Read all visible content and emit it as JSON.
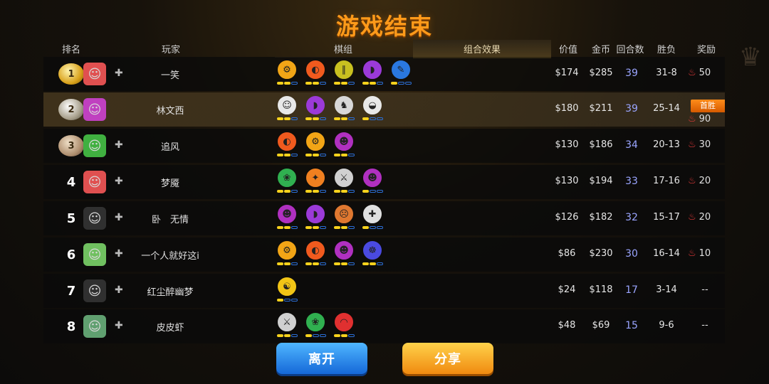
{
  "title": "游戏结束",
  "headers": {
    "rank": "排名",
    "player": "玩家",
    "pieces": "棋组",
    "combo": "组合效果",
    "value": "价值",
    "gold": "金币",
    "rounds": "回合数",
    "winloss": "胜负",
    "reward": "奖励"
  },
  "buttons": {
    "leave": "离开",
    "share": "分享"
  },
  "first_win_badge": "首胜",
  "rows": [
    {
      "rank": "1",
      "medal": "gold",
      "name": "一笑",
      "friend": true,
      "avatar_bg": "#e05050",
      "value": "$174",
      "gold": "$285",
      "rounds": "39",
      "wl": "31-8",
      "reward": "50",
      "synergies": [
        {
          "color": "#f2a516",
          "icon": "⚙",
          "bars": [
            1,
            1,
            0
          ]
        },
        {
          "color": "#f05a1e",
          "icon": "◐",
          "bars": [
            1,
            1,
            0
          ]
        },
        {
          "color": "#c8c020",
          "icon": "∥",
          "bars": [
            1,
            1,
            0
          ]
        },
        {
          "color": "#9b3ad8",
          "icon": "◗",
          "bars": [
            1,
            1,
            0
          ]
        },
        {
          "color": "#2a78e0",
          "icon": "✎",
          "bars": [
            1,
            0,
            0
          ]
        }
      ]
    },
    {
      "rank": "2",
      "medal": "silver",
      "name": "林文西",
      "friend": false,
      "avatar_bg": "#c040c0",
      "value": "$180",
      "gold": "$211",
      "rounds": "39",
      "wl": "25-14",
      "reward": "90",
      "first_win": true,
      "synergies": [
        {
          "color": "#e8e8e8",
          "icon": "☺",
          "bars": [
            1,
            1,
            0
          ]
        },
        {
          "color": "#9b3ad8",
          "icon": "◗",
          "bars": [
            1,
            1,
            0
          ]
        },
        {
          "color": "#d8d8d8",
          "icon": "♞",
          "bars": [
            1,
            1,
            0
          ]
        },
        {
          "color": "#e8e8e8",
          "icon": "◒",
          "bars": [
            1,
            0,
            0
          ]
        }
      ]
    },
    {
      "rank": "3",
      "medal": "bronze",
      "name": "追风",
      "friend": true,
      "avatar_bg": "#40b040",
      "value": "$130",
      "gold": "$186",
      "rounds": "34",
      "wl": "20-13",
      "reward": "30",
      "synergies": [
        {
          "color": "#f05a1e",
          "icon": "◐",
          "bars": [
            1,
            1,
            0
          ]
        },
        {
          "color": "#f2a516",
          "icon": "⚙",
          "bars": [
            1,
            1,
            0
          ]
        },
        {
          "color": "#b030c0",
          "icon": "☻",
          "bars": [
            1,
            1,
            0
          ]
        }
      ]
    },
    {
      "rank": "4",
      "medal": "",
      "name": "梦魇",
      "friend": true,
      "avatar_bg": "#e05050",
      "value": "$130",
      "gold": "$194",
      "rounds": "33",
      "wl": "17-16",
      "reward": "20",
      "synergies": [
        {
          "color": "#30b050",
          "icon": "❀",
          "bars": [
            1,
            1,
            0
          ]
        },
        {
          "color": "#f08020",
          "icon": "✦",
          "bars": [
            1,
            1,
            0
          ]
        },
        {
          "color": "#d0d0d0",
          "icon": "⚔",
          "bars": [
            1,
            1,
            0
          ]
        },
        {
          "color": "#b030c0",
          "icon": "☻",
          "bars": [
            1,
            0,
            0
          ]
        }
      ]
    },
    {
      "rank": "5",
      "medal": "",
      "name": "卧　无情",
      "friend": true,
      "avatar_bg": "#303030",
      "value": "$126",
      "gold": "$182",
      "rounds": "32",
      "wl": "15-17",
      "reward": "20",
      "synergies": [
        {
          "color": "#b030c0",
          "icon": "☻",
          "bars": [
            1,
            1,
            0
          ]
        },
        {
          "color": "#9b3ad8",
          "icon": "◗",
          "bars": [
            1,
            1,
            0
          ]
        },
        {
          "color": "#e07830",
          "icon": "☹",
          "bars": [
            1,
            1,
            0
          ]
        },
        {
          "color": "#e0e0e0",
          "icon": "✚",
          "bars": [
            1,
            0,
            0
          ]
        }
      ]
    },
    {
      "rank": "6",
      "medal": "",
      "name": "一个人就好这i",
      "friend": true,
      "avatar_bg": "#70c060",
      "value": "$86",
      "gold": "$230",
      "rounds": "30",
      "wl": "16-14",
      "reward": "10",
      "synergies": [
        {
          "color": "#f2a516",
          "icon": "⚙",
          "bars": [
            1,
            1,
            0
          ]
        },
        {
          "color": "#f05a1e",
          "icon": "◐",
          "bars": [
            1,
            1,
            0
          ]
        },
        {
          "color": "#b030c0",
          "icon": "☻",
          "bars": [
            1,
            1,
            0
          ]
        },
        {
          "color": "#4a4ae0",
          "icon": "☸",
          "bars": [
            1,
            1,
            0
          ]
        }
      ]
    },
    {
      "rank": "7",
      "medal": "",
      "name": "红尘醉幽梦",
      "friend": true,
      "avatar_bg": "#303030",
      "value": "$24",
      "gold": "$118",
      "rounds": "17",
      "wl": "3-14",
      "reward": "--",
      "synergies": [
        {
          "color": "#f2c516",
          "icon": "☯",
          "bars": [
            1,
            0,
            0
          ]
        }
      ]
    },
    {
      "rank": "8",
      "medal": "",
      "name": "皮皮虾",
      "friend": true,
      "avatar_bg": "#60a070",
      "value": "$48",
      "gold": "$69",
      "rounds": "15",
      "wl": "9-6",
      "reward": "--",
      "synergies": [
        {
          "color": "#d0d0d0",
          "icon": "⚔",
          "bars": [
            1,
            1,
            0
          ]
        },
        {
          "color": "#30b050",
          "icon": "❀",
          "bars": [
            1,
            0,
            0
          ]
        },
        {
          "color": "#e03030",
          "icon": "◠",
          "bars": [
            1,
            1,
            0
          ]
        }
      ]
    }
  ]
}
